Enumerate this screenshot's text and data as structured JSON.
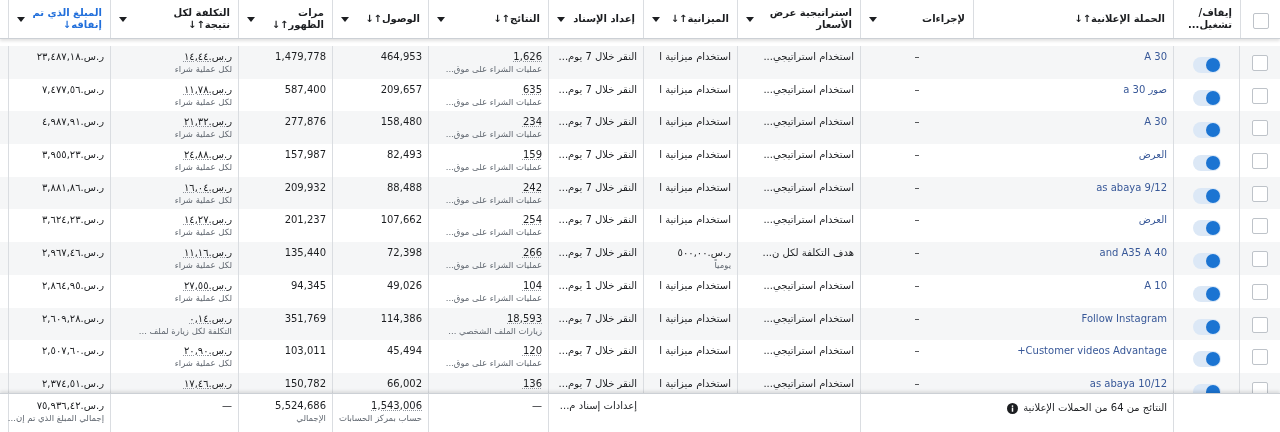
{
  "columns": [
    {
      "kind": "checkbox",
      "checked": false
    },
    {
      "kind": "text",
      "label": "إيقاف/ تشغيل...",
      "menu": false,
      "sorted": false
    },
    {
      "kind": "text",
      "label": "الحملة الإعلانية",
      "sort": "↑↓",
      "menu": false,
      "sorted": false
    },
    {
      "kind": "text",
      "label": "لإجراءات",
      "menu": true,
      "sorted": false
    },
    {
      "kind": "text",
      "label": "استراتيجية عرض الأسعار",
      "menu": true,
      "sorted": false
    },
    {
      "kind": "text",
      "label": "الميزانية",
      "sort": "↑↓",
      "menu": true,
      "sorted": false
    },
    {
      "kind": "text",
      "label": "إعداد الإسناد",
      "menu": true,
      "sorted": false
    },
    {
      "kind": "text",
      "label": "النتائج",
      "sort": "↑↓",
      "menu": true,
      "sorted": false
    },
    {
      "kind": "text",
      "label": "الوصول",
      "sort": "↑↓",
      "menu": true,
      "sorted": false
    },
    {
      "kind": "text",
      "label": "مرات الظهور",
      "sort": "↑↓",
      "menu": true,
      "sorted": false
    },
    {
      "kind": "text",
      "label": "التكلفة لكل نتيجة",
      "sort": "↑↓",
      "menu": true,
      "sorted": false
    },
    {
      "kind": "text",
      "label": "المبلغ الذي تم إنفاقه",
      "sort": "↓",
      "menu": true,
      "sorted": true
    }
  ],
  "rows": [
    {
      "checked": false,
      "on": true,
      "campaign": "A 30",
      "actions": "–",
      "bid_strategy": "استخدام استراتيجي...",
      "budget": {
        "value": "استخدام ميزانية ا"
      },
      "attribution": "النقر خلال 7 يوم...",
      "results": {
        "value": "1,626",
        "label": "عمليات الشراء على موق..."
      },
      "reach": "464,953",
      "impressions": "1,479,778",
      "cost": {
        "value": "ر.س.١٤,٤٤",
        "label": "لكل عملية شراء"
      },
      "spent": "ر.س.٢٣,٤٨٧,١٨"
    },
    {
      "checked": false,
      "on": true,
      "campaign": "صور 30 a",
      "actions": "–",
      "bid_strategy": "استخدام استراتيجي...",
      "budget": {
        "value": "استخدام ميزانية ا"
      },
      "attribution": "النقر خلال 7 يوم...",
      "results": {
        "value": "635",
        "label": "عمليات الشراء على موق..."
      },
      "reach": "209,657",
      "impressions": "587,400",
      "cost": {
        "value": "ر.س.١١,٧٨",
        "label": "لكل عملية شراء"
      },
      "spent": "ر.س.٧,٤٧٧,٥٦"
    },
    {
      "checked": false,
      "on": true,
      "campaign": "A 30",
      "actions": "–",
      "bid_strategy": "استخدام استراتيجي...",
      "budget": {
        "value": "استخدام ميزانية ا"
      },
      "attribution": "النقر خلال 7 يوم...",
      "results": {
        "value": "234",
        "label": "عمليات الشراء على موق..."
      },
      "reach": "158,480",
      "impressions": "277,876",
      "cost": {
        "value": "ر.س.٢١,٣٢",
        "label": "لكل عملية شراء"
      },
      "spent": "ر.س.٤,٩٨٧,٩١"
    },
    {
      "checked": false,
      "on": true,
      "campaign": "العرض",
      "actions": "–",
      "bid_strategy": "استخدام استراتيجي...",
      "budget": {
        "value": "استخدام ميزانية ا"
      },
      "attribution": "النقر خلال 7 يوم...",
      "results": {
        "value": "159",
        "label": "عمليات الشراء على موق..."
      },
      "reach": "82,493",
      "impressions": "157,987",
      "cost": {
        "value": "ر.س.٢٤,٨٨",
        "label": "لكل عملية شراء"
      },
      "spent": "ر.س.٣,٩٥٥,٢٣"
    },
    {
      "checked": false,
      "on": true,
      "campaign": "as abaya 9/12",
      "actions": "–",
      "bid_strategy": "استخدام استراتيجي...",
      "budget": {
        "value": "استخدام ميزانية ا"
      },
      "attribution": "النقر خلال 7 يوم...",
      "results": {
        "value": "242",
        "label": "عمليات الشراء على موق..."
      },
      "reach": "88,488",
      "impressions": "209,932",
      "cost": {
        "value": "ر.س.١٦,٠٤",
        "label": "لكل عملية شراء"
      },
      "spent": "ر.س.٣,٨٨١,٨٦"
    },
    {
      "checked": false,
      "on": true,
      "campaign": "العرض",
      "actions": "–",
      "bid_strategy": "استخدام استراتيجي...",
      "budget": {
        "value": "استخدام ميزانية ا"
      },
      "attribution": "النقر خلال 7 يوم...",
      "results": {
        "value": "254",
        "label": "عمليات الشراء على موق..."
      },
      "reach": "107,662",
      "impressions": "201,237",
      "cost": {
        "value": "ر.س.١٤,٢٧",
        "label": "لكل عملية شراء"
      },
      "spent": "ر.س.٣,٦٢٤,٢٣"
    },
    {
      "checked": false,
      "on": true,
      "campaign": "and A35 A 40",
      "actions": "–",
      "bid_strategy": "هدف التكلفة لكل ن...",
      "budget": {
        "value": "ر.س.٥٠٠,٠٠",
        "label": "يومياً"
      },
      "attribution": "النقر خلال 7 يوم...",
      "results": {
        "value": "266",
        "label": "عمليات الشراء على موق..."
      },
      "reach": "72,398",
      "impressions": "135,440",
      "cost": {
        "value": "ر.س.١١,١٦",
        "label": "لكل عملية شراء"
      },
      "spent": "ر.س.٢,٩٦٧,٤٦"
    },
    {
      "checked": false,
      "on": true,
      "campaign": "A 10",
      "actions": "–",
      "bid_strategy": "استخدام استراتيجي...",
      "budget": {
        "value": "استخدام ميزانية ا"
      },
      "attribution": "النقر خلال 1 يوم...",
      "results": {
        "value": "104",
        "label": "عمليات الشراء على موق..."
      },
      "reach": "49,026",
      "impressions": "94,345",
      "cost": {
        "value": "ر.س.٢٧,٥٥",
        "label": "لكل عملية شراء"
      },
      "spent": "ر.س.٢,٨٦٤,٩٥"
    },
    {
      "checked": false,
      "on": true,
      "campaign": "Follow Instagram",
      "actions": "–",
      "bid_strategy": "استخدام استراتيجي...",
      "budget": {
        "value": "استخدام ميزانية ا"
      },
      "attribution": "النقر خلال 7 يوم...",
      "results": {
        "value": "18,593",
        "label": "زيارات الملف الشخصي ..."
      },
      "reach": "114,386",
      "impressions": "351,769",
      "cost": {
        "value": "ر.س.٠,١٤",
        "label": "التكلفة لكل زيارة لملف ..."
      },
      "spent": "ر.س.٢,٦٠٩,٢٨"
    },
    {
      "checked": false,
      "on": true,
      "campaign": "Customer videos Advantage+",
      "actions": "–",
      "bid_strategy": "استخدام استراتيجي...",
      "budget": {
        "value": "استخدام ميزانية ا"
      },
      "attribution": "النقر خلال 7 يوم...",
      "results": {
        "value": "120",
        "label": "عمليات الشراء على موق..."
      },
      "reach": "45,494",
      "impressions": "103,011",
      "cost": {
        "value": "ر.س.٢٠,٩٠",
        "label": "لكل عملية شراء"
      },
      "spent": "ر.س.٢,٥٠٧,٦٠"
    },
    {
      "checked": false,
      "on": true,
      "campaign": "as abaya 10/12",
      "actions": "–",
      "bid_strategy": "استخدام استراتيجي...",
      "budget": {
        "value": "استخدام ميزانية ا"
      },
      "attribution": "النقر خلال 7 يوم...",
      "results": {
        "value": "136"
      },
      "reach": "66,002",
      "impressions": "150,782",
      "cost": {
        "value": "ر.س.١٧,٤٦"
      },
      "spent": "ر.س.٢,٣٧٤,٥١"
    }
  ],
  "footer": {
    "summary": "النتائج من 64 من الحملات الإعلانية",
    "attribution": "إعدادات إسناد م...",
    "results": "—",
    "reach": {
      "value": "1,543,006",
      "label": "حساب بمركز الحسابات"
    },
    "impressions": {
      "value": "5,524,686",
      "label": "الإجمالي"
    },
    "cost": "—",
    "spent": {
      "value": "ر.س.٧٥,٩٣٦,٤٢",
      "label": "إجمالي المبلغ الذي تم إن..."
    }
  }
}
